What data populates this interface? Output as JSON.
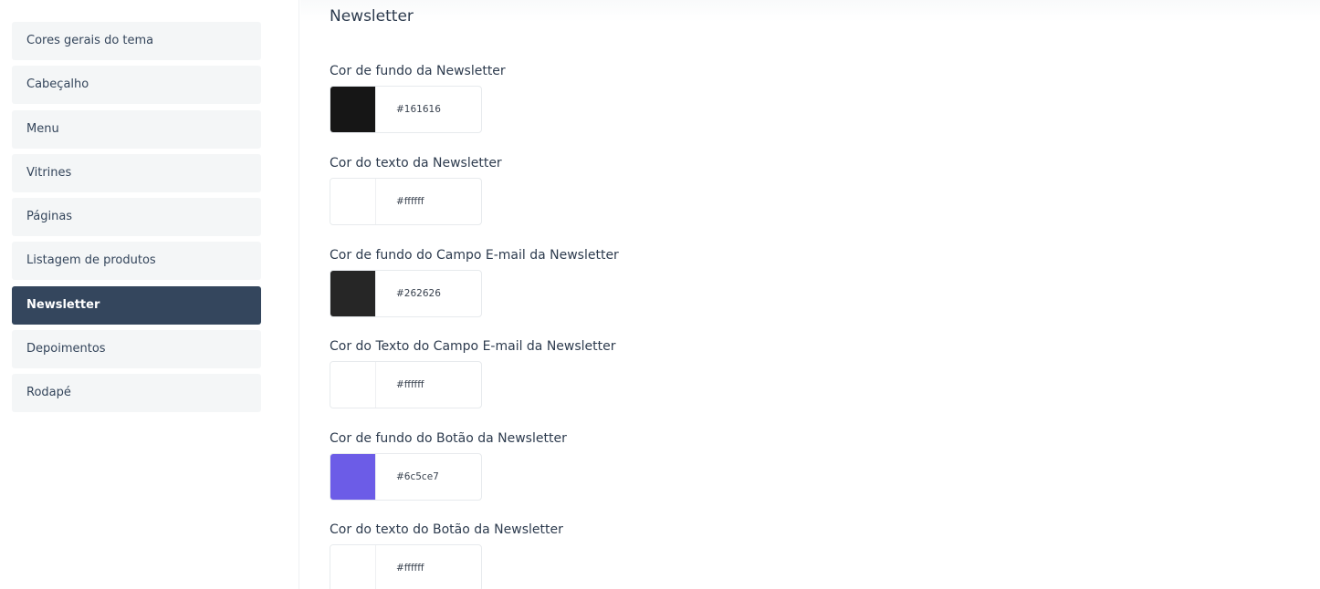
{
  "sidebar": {
    "items": [
      {
        "label": "Cores gerais do tema"
      },
      {
        "label": "Cabeçalho"
      },
      {
        "label": "Menu"
      },
      {
        "label": "Vitrines"
      },
      {
        "label": "Páginas"
      },
      {
        "label": "Listagem de produtos"
      },
      {
        "label": "Newsletter"
      },
      {
        "label": "Depoimentos"
      },
      {
        "label": "Rodapé"
      }
    ],
    "active_item": "Newsletter"
  },
  "main": {
    "title": "Newsletter",
    "fields": [
      {
        "label": "Cor de fundo da Newsletter",
        "value": "#161616",
        "swatch_color": "#161616"
      },
      {
        "label": "Cor do texto da Newsletter",
        "value": "#ffffff",
        "swatch_color": "#ffffff"
      },
      {
        "label": "Cor de fundo do Campo E-mail da Newsletter",
        "value": "#262626",
        "swatch_color": "#262626"
      },
      {
        "label": "Cor do Texto do Campo E-mail da Newsletter",
        "value": "#ffffff",
        "swatch_color": "#ffffff"
      },
      {
        "label": "Cor de fundo do Botão da Newsletter",
        "value": "#6c5ce7",
        "swatch_color": "#6c5ce7"
      },
      {
        "label": "Cor do texto do Botão da Newsletter",
        "value": "#ffffff",
        "swatch_color": "#ffffff"
      }
    ]
  },
  "colors": {
    "sidebar_active_bg": "#34465d",
    "sidebar_item_bg": "#f4f6f7",
    "text": "#2d3b4e"
  }
}
